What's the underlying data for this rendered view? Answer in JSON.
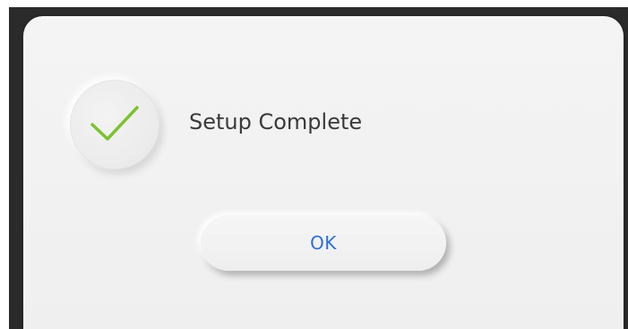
{
  "dialog": {
    "icon": "checkmark-icon",
    "accent_color": "#7cc230",
    "title": "Setup Complete",
    "ok_label": "OK",
    "ok_color": "#2f6fd8"
  }
}
